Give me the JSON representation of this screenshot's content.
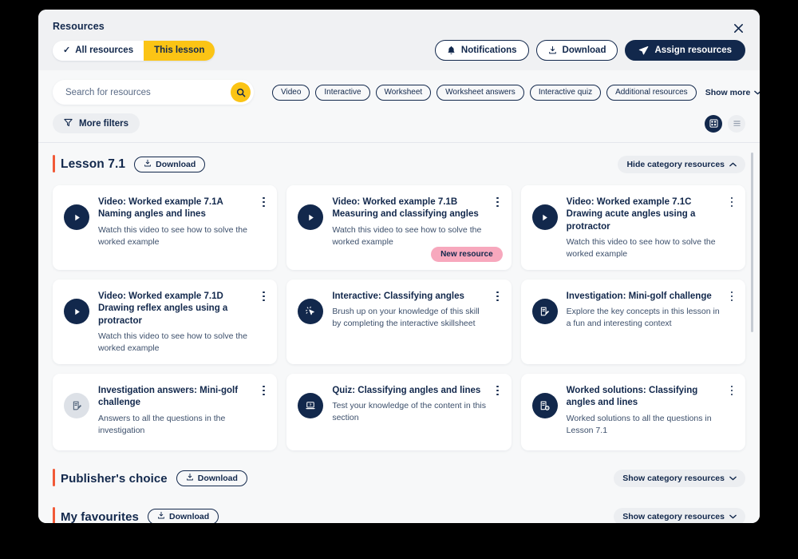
{
  "modal": {
    "title": "Resources",
    "close_icon": "close-icon"
  },
  "toggle": {
    "all_resources": "All resources",
    "this_lesson": "This lesson",
    "active": "This lesson",
    "check_glyph": "✓"
  },
  "header_actions": {
    "notifications": "Notifications",
    "download": "Download",
    "assign": "Assign resources"
  },
  "search": {
    "placeholder": "Search for resources",
    "value": "",
    "button_icon": "search-icon"
  },
  "chips": [
    "Video",
    "Interactive",
    "Worksheet",
    "Worksheet answers",
    "Interactive quiz",
    "Additional resources"
  ],
  "show_more": "Show more",
  "more_filters": "More filters",
  "view": {
    "grid": "grid-view-icon",
    "list": "list-view-icon",
    "active": "grid"
  },
  "categories": [
    {
      "title": "Lesson 7.1",
      "download_label": "Download",
      "toggle_label": "Hide category resources",
      "expanded": true,
      "accent": "#f15a38",
      "cards": [
        {
          "icon": "play-icon",
          "icon_style": "solid",
          "title": "Video: Worked example 7.1A Naming angles and lines",
          "desc": "Watch this video to see how to solve the worked example",
          "badge": ""
        },
        {
          "icon": "play-icon",
          "icon_style": "solid",
          "title": "Video: Worked example 7.1B Measuring and classifying angles",
          "desc": "Watch this video to see how to solve the worked example",
          "badge": "New resource"
        },
        {
          "icon": "play-icon",
          "icon_style": "solid",
          "title": "Video: Worked example 7.1C  Drawing acute angles using a protractor",
          "desc": "Watch this video to see how to solve the worked example",
          "badge": ""
        },
        {
          "icon": "play-icon",
          "icon_style": "solid",
          "title": "Video: Worked example 7.1D Drawing reflex angles using a protractor",
          "desc": "Watch this video to see how to solve the worked example",
          "badge": ""
        },
        {
          "icon": "cursor-click-icon",
          "icon_style": "solid",
          "title": "Interactive: Classifying angles",
          "desc": "Brush up on your knowledge of this skill by completing the interactive skillsheet",
          "badge": ""
        },
        {
          "icon": "document-edit-icon",
          "icon_style": "solid",
          "title": "Investigation: Mini-golf challenge",
          "desc": "Explore the key concepts in this lesson in a fun and interesting context",
          "badge": ""
        },
        {
          "icon": "document-edit-icon",
          "icon_style": "muted",
          "title": "Investigation answers: Mini-golf challenge",
          "desc": "Answers to all the questions in the investigation",
          "badge": ""
        },
        {
          "icon": "quiz-laptop-icon",
          "icon_style": "solid",
          "title": "Quiz: Classifying angles and lines",
          "desc": "Test your knowledge of the content in this section",
          "badge": ""
        },
        {
          "icon": "document-plus-icon",
          "icon_style": "solid",
          "title": "Worked solutions: Classifying angles and lines",
          "desc": "Worked solutions to all the questions in Lesson 7.1",
          "badge": ""
        }
      ]
    },
    {
      "title": "Publisher's choice",
      "download_label": "Download",
      "toggle_label": "Show category resources",
      "expanded": false,
      "accent": "#f15a38",
      "cards": []
    },
    {
      "title": "My favourites",
      "download_label": "Download",
      "toggle_label": "Show category resources",
      "expanded": false,
      "accent": "#f15a38",
      "cards": []
    }
  ],
  "colors": {
    "navy": "#12284c",
    "yellow": "#fbc415",
    "orange_accent": "#f15a38",
    "badge_pink": "#f7a8bd",
    "panel_bg": "#f7f8f9",
    "header_bg": "#f0f1f3"
  }
}
